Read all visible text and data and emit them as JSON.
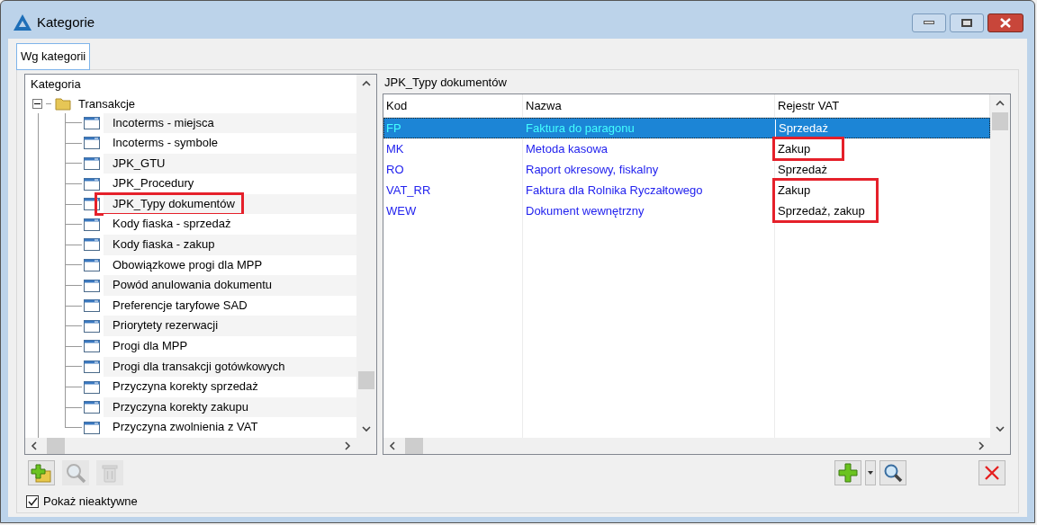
{
  "window": {
    "title": "Kategorie"
  },
  "tabs": [
    {
      "label": "Wg kategorii",
      "selected": true
    }
  ],
  "tree": {
    "header": "Kategoria",
    "root": {
      "label": "Transakcje",
      "expanded": true,
      "children": [
        {
          "label": "Incoterms - miejsca",
          "highlighted": false
        },
        {
          "label": "Incoterms - symbole",
          "highlighted": false
        },
        {
          "label": "JPK_GTU",
          "highlighted": false
        },
        {
          "label": "JPK_Procedury",
          "highlighted": false
        },
        {
          "label": "JPK_Typy dokumentów",
          "highlighted": true
        },
        {
          "label": "Kody fiaska - sprzedaż",
          "highlighted": false
        },
        {
          "label": "Kody fiaska - zakup",
          "highlighted": false
        },
        {
          "label": "Obowiązkowe progi dla MPP",
          "highlighted": false
        },
        {
          "label": "Powód anulowania dokumentu",
          "highlighted": false
        },
        {
          "label": "Preferencje taryfowe SAD",
          "highlighted": false
        },
        {
          "label": "Priorytety rezerwacji",
          "highlighted": false
        },
        {
          "label": "Progi dla MPP",
          "highlighted": false
        },
        {
          "label": "Progi dla transakcji gotówkowych",
          "highlighted": false
        },
        {
          "label": "Przyczyna korekty sprzedaż",
          "highlighted": false
        },
        {
          "label": "Przyczyna korekty zakupu",
          "highlighted": false
        },
        {
          "label": "Przyczyna zwolnienia z VAT",
          "highlighted": false
        }
      ]
    }
  },
  "table": {
    "title": "JPK_Typy dokumentów",
    "columns": [
      "Kod",
      "Nazwa",
      "Rejestr VAT"
    ],
    "rows": [
      {
        "kod": "FP",
        "nazwa": "Faktura do paragonu",
        "rejestr": "Sprzedaż",
        "selected": true,
        "marked": false
      },
      {
        "kod": "MK",
        "nazwa": "Metoda kasowa",
        "rejestr": "Zakup",
        "selected": false,
        "marked": true
      },
      {
        "kod": "RO",
        "nazwa": "Raport okresowy, fiskalny",
        "rejestr": "Sprzedaż",
        "selected": false,
        "marked": false
      },
      {
        "kod": "VAT_RR",
        "nazwa": "Faktura dla Rolnika Ryczałtowego",
        "rejestr": "Zakup",
        "selected": false,
        "marked": true
      },
      {
        "kod": "WEW",
        "nazwa": "Dokument wewnętrzny",
        "rejestr": "Sprzedaż, zakup",
        "selected": false,
        "marked": true
      }
    ]
  },
  "left_toolbar": [
    {
      "kind": "add-folder",
      "disabled": false
    },
    {
      "kind": "search",
      "disabled": true
    },
    {
      "kind": "delete",
      "disabled": true
    }
  ],
  "show_inactive": {
    "label": "Pokaż nieaktywne",
    "checked": true
  }
}
